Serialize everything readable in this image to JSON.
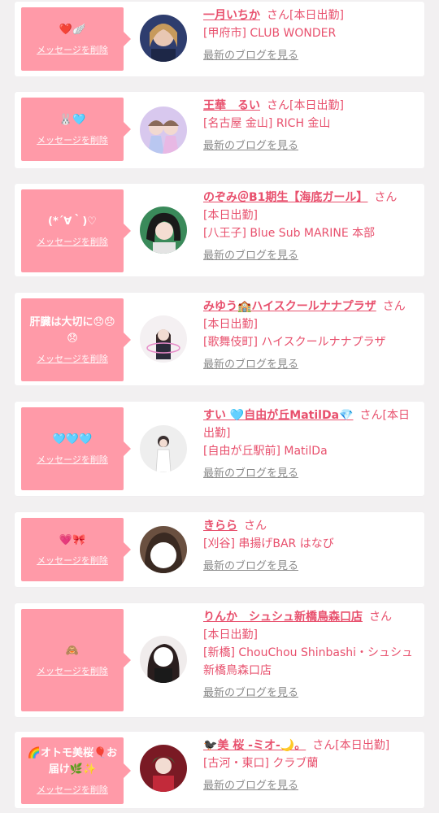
{
  "delete_label": "メッセージを削除",
  "blog_label": "最新のブログを見る",
  "san_label": "さん",
  "colors": {
    "accent": "#e8506d",
    "bubble": "#ff9aa8",
    "link_gray": "#8a8a8a",
    "page_bg": "#f2f0f1"
  },
  "items": [
    {
      "message": "❤️🪽",
      "name": "一月いちか",
      "status": "[本日出勤]",
      "shop": "[甲府市] CLUB WONDER"
    },
    {
      "message": "🐰🩵",
      "name": "王華　るい",
      "status": "[本日出勤]",
      "shop": "[名古屋 金山] RICH 金山"
    },
    {
      "message": "(*´∀｀)♡",
      "name": "のぞみ＠B1期生【海底ガール】",
      "status": "[本日出勤]",
      "shop": "[八王子] Blue Sub MARINE 本部"
    },
    {
      "message": "肝臓は大切に😞😞😞",
      "name": "みゆう🏫ハイスクールナナプラザ",
      "status": "[本日出勤]",
      "shop": "[歌舞伎町] ハイスクールナナプラザ"
    },
    {
      "message": "🩵🩵🩵",
      "name": "すい 🩵自由が丘MatilDa💎",
      "status": "[本日出勤]",
      "shop": "[自由が丘駅前] MatilDa"
    },
    {
      "message": "💗🎀",
      "name": "きらら",
      "status": "",
      "shop": "[刈谷] 串揚げBAR はなび"
    },
    {
      "message": "🙈",
      "name": "りんか　シュシュ新橋鳥森口店",
      "status": "[本日出勤]",
      "shop": "[新橋] ChouChou Shinbashi・シュシュ新橋鳥森口店"
    },
    {
      "message": "🌈オトモ美桜🎈お届け🌿✨",
      "name": "🐦‍⬛美 桜 -ミオ-🌙。",
      "status": "[本日出勤]",
      "shop": "[古河・東口] クラブ蘭"
    }
  ]
}
